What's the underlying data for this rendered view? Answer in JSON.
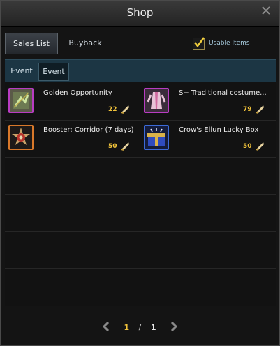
{
  "window": {
    "title": "Shop"
  },
  "tabs": [
    {
      "label": "Sales List",
      "active": true
    },
    {
      "label": "Buyback",
      "active": false
    }
  ],
  "usable_items": {
    "label": "Usable Items",
    "checked": true
  },
  "subtabs": [
    {
      "label": "Event",
      "active": false
    },
    {
      "label": "Event",
      "active": true
    }
  ],
  "items": [
    {
      "name": "Golden Opportunity",
      "price": "22",
      "icon": "golden-opportunity-icon",
      "frame_color": "#b83cc2"
    },
    {
      "name": "S+ Traditional costume...",
      "price": "79",
      "icon": "traditional-costume-icon",
      "frame_color": "#b83cc2"
    },
    {
      "name": "Booster: Corridor (7 days)",
      "price": "50",
      "icon": "booster-medal-icon",
      "frame_color": "#d8782a"
    },
    {
      "name": "Crow's Ellun Lucky Box",
      "price": "50",
      "icon": "lucky-box-icon",
      "frame_color": "#3c6ad8"
    }
  ],
  "pagination": {
    "current": "1",
    "separator": "/",
    "total": "1"
  },
  "colors": {
    "price": "#f0c23a",
    "subtab_bar": "#1c3644",
    "accent_label": "#a8cde0"
  }
}
